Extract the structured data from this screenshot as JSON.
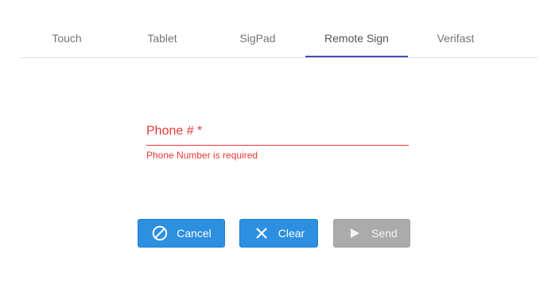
{
  "tabs": [
    {
      "label": "Touch",
      "active": false
    },
    {
      "label": "Tablet",
      "active": false
    },
    {
      "label": "SigPad",
      "active": false
    },
    {
      "label": "Remote Sign",
      "active": true
    },
    {
      "label": "Verifast",
      "active": false
    }
  ],
  "phone_field": {
    "label": "Phone # *",
    "value": "",
    "error": "Phone Number is required"
  },
  "buttons": {
    "cancel": {
      "label": "Cancel",
      "icon": "ban-icon"
    },
    "clear": {
      "label": "Clear",
      "icon": "close-icon"
    },
    "send": {
      "label": "Send",
      "icon": "play-icon",
      "disabled": true
    }
  },
  "colors": {
    "accent": "#3f51b5",
    "error": "#e53935",
    "primary_button": "#2d8fe0",
    "disabled_button": "#ababab"
  }
}
